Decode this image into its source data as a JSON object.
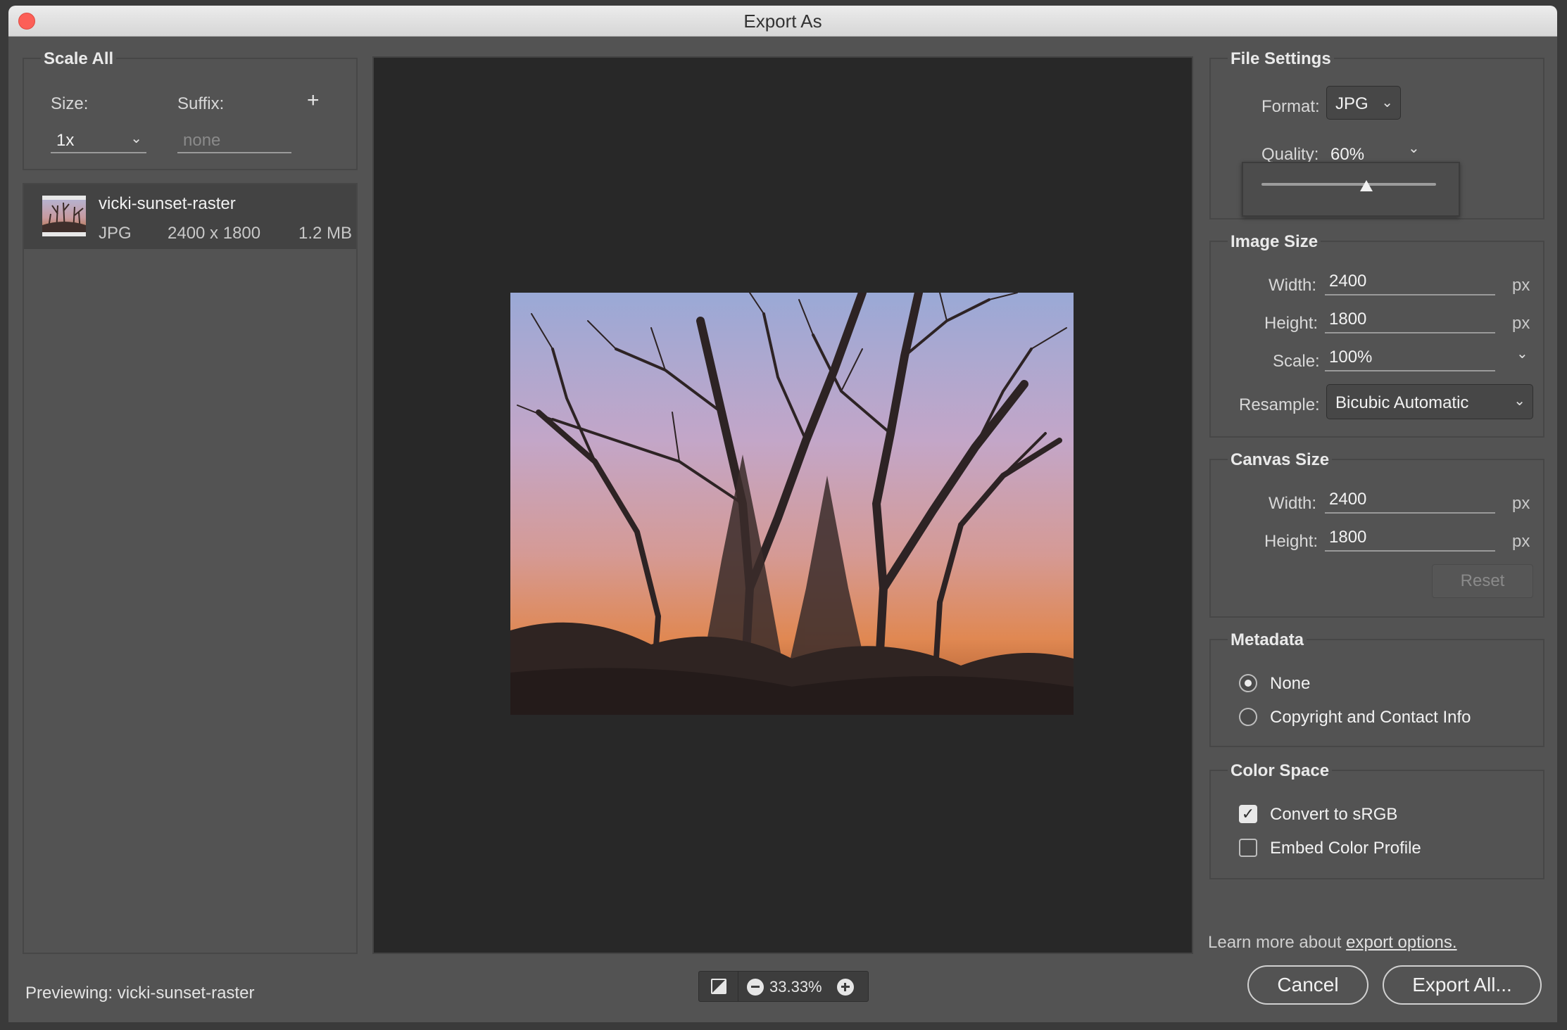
{
  "window": {
    "title": "Export As"
  },
  "scale_all": {
    "legend": "Scale All",
    "size_label": "Size:",
    "suffix_label": "Suffix:",
    "add_glyph": "+",
    "size_value": "1x",
    "suffix_placeholder": "none"
  },
  "asset": {
    "name": "vicki-sunset-raster",
    "format": "JPG",
    "dimensions": "2400 x 1800",
    "filesize": "1.2 MB"
  },
  "file_settings": {
    "legend": "File Settings",
    "format_label": "Format:",
    "format_value": "JPG",
    "quality_label": "Quality:",
    "quality_value": "60%",
    "quality_fraction": 0.6
  },
  "image_size": {
    "legend": "Image Size",
    "width_label": "Width:",
    "width_value": "2400",
    "height_label": "Height:",
    "height_value": "1800",
    "scale_label": "Scale:",
    "scale_value": "100%",
    "resample_label": "Resample:",
    "resample_value": "Bicubic Automatic",
    "unit": "px"
  },
  "canvas_size": {
    "legend": "Canvas Size",
    "width_label": "Width:",
    "width_value": "2400",
    "height_label": "Height:",
    "height_value": "1800",
    "unit": "px",
    "reset_label": "Reset"
  },
  "metadata": {
    "legend": "Metadata",
    "options": [
      {
        "label": "None",
        "selected": true
      },
      {
        "label": "Copyright and Contact Info",
        "selected": false
      }
    ]
  },
  "color_space": {
    "legend": "Color Space",
    "options": [
      {
        "label": "Convert to sRGB",
        "checked": true
      },
      {
        "label": "Embed Color Profile",
        "checked": false
      }
    ]
  },
  "learn_more": {
    "text": "Learn more about ",
    "link": "export options."
  },
  "footer": {
    "previewing_label": "Previewing:",
    "previewing_name": "vicki-sunset-raster",
    "zoom": "33.33%",
    "cancel_label": "Cancel",
    "export_label": "Export All..."
  },
  "colors": {
    "dialog_bg": "#535353",
    "preview_bg": "#282828",
    "close_button": "#fc5f57"
  }
}
